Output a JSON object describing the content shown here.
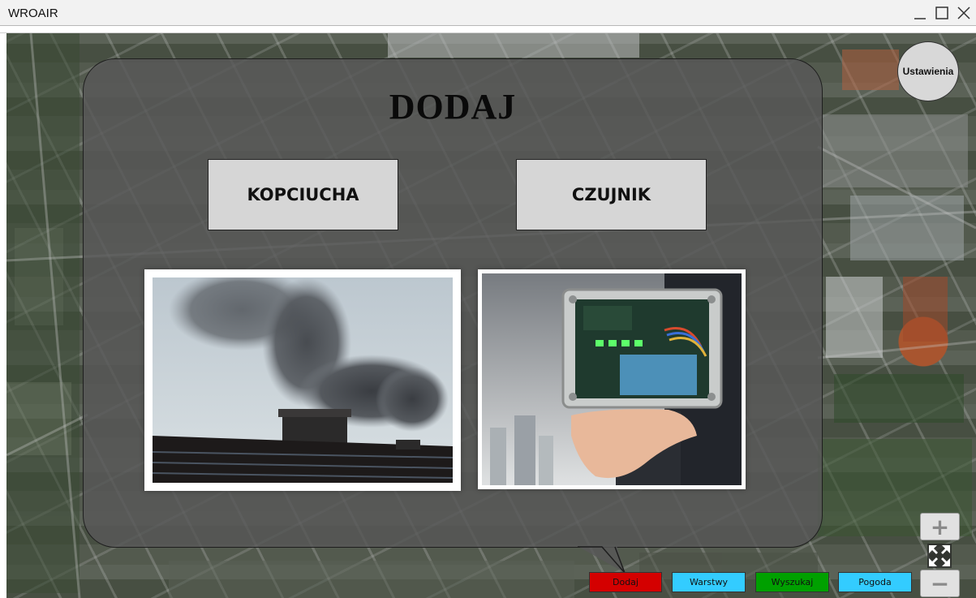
{
  "window": {
    "title": "WROAIR",
    "minimize_icon": "minimize-icon",
    "maximize_icon": "maximize-icon",
    "close_icon": "close-icon"
  },
  "settings": {
    "label": "Ustawienia"
  },
  "panel": {
    "title": "DODAJ",
    "buttons": [
      {
        "label": "KOPCIUCHA"
      },
      {
        "label": "CZUJNIK"
      }
    ],
    "images": [
      {
        "depicts": "chimney-smoke-photo"
      },
      {
        "depicts": "sensor-device-photo"
      }
    ]
  },
  "zoom": {
    "in_label": "+",
    "out_label": "−",
    "fullscreen_icon": "fullscreen-icon"
  },
  "tabs": [
    {
      "label": "Dodaj",
      "color": "#d40000"
    },
    {
      "label": "Warstwy",
      "color": "#33ccff"
    },
    {
      "label": "Wyszukaj",
      "color": "#00a000"
    },
    {
      "label": "Pogoda",
      "color": "#33ccff"
    }
  ]
}
